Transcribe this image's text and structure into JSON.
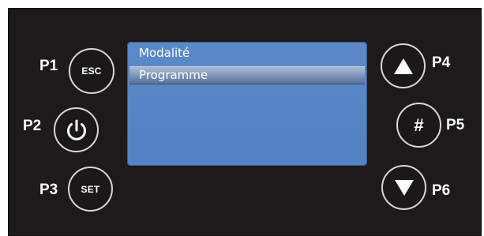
{
  "labels": {
    "p1": "P1",
    "p2": "P2",
    "p3": "P3",
    "p4": "P4",
    "p5": "P5",
    "p6": "P6"
  },
  "buttons": {
    "esc": "ESC",
    "power_icon": "power-icon",
    "set": "SET",
    "up_icon": "triangle-up-icon",
    "hash": "#",
    "down_icon": "triangle-down-icon"
  },
  "screen": {
    "items": [
      "Modalité",
      "Programme"
    ],
    "selected_index": 1
  },
  "colors": {
    "panel": "#1c1a1a",
    "screen": "#5686c6",
    "button_ring": "#d8d8d8",
    "text": "#ffffff"
  }
}
